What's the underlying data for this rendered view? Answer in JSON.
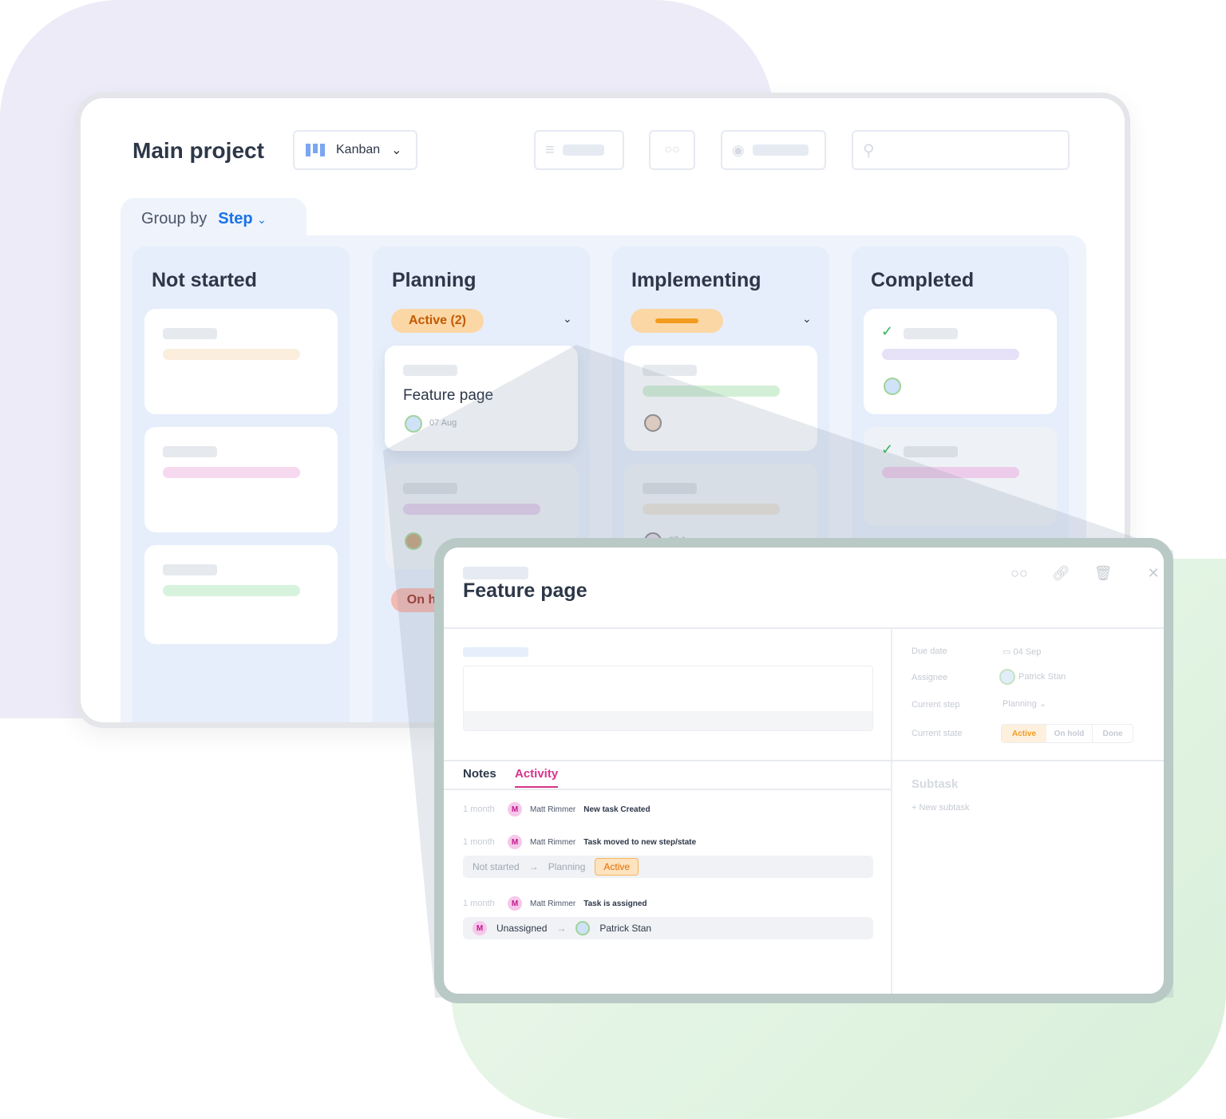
{
  "header": {
    "title": "Main project",
    "view": "Kanban"
  },
  "group_by": {
    "label": "Group by",
    "value": "Step"
  },
  "columns": [
    {
      "title": "Not started"
    },
    {
      "title": "Planning",
      "chip": "Active (2)",
      "chip2": "On hold",
      "card": {
        "title": "Feature page",
        "date": "07 Aug"
      }
    },
    {
      "title": "Implementing",
      "date": "07 Aug"
    },
    {
      "title": "Completed"
    }
  ],
  "detail": {
    "title": "Feature page",
    "fields": {
      "due_label": "Due date",
      "due": "04 Sep",
      "assignee_label": "Assignee",
      "assignee": "Patrick Stan",
      "step_label": "Current step",
      "step": "Planning",
      "state_label": "Current state",
      "states": [
        "Active",
        "On hold",
        "Done"
      ]
    },
    "tabs": [
      "Notes",
      "Activity"
    ],
    "subtask": {
      "title": "Subtask",
      "new": "+ New subtask"
    },
    "activity": [
      {
        "time": "1 month",
        "avatar": "M",
        "user": "Matt Rimmer",
        "text": "New task Created"
      },
      {
        "time": "1 month",
        "avatar": "M",
        "user": "Matt Rimmer",
        "text": "Task moved to new step/state",
        "from": "Not started",
        "to": "Planning",
        "state": "Active"
      },
      {
        "time": "1 month",
        "avatar": "M",
        "user": "Matt Rimmer",
        "text": "Task is assigned",
        "from": "Unassigned",
        "to": "Patrick Stan"
      }
    ]
  },
  "colors": {
    "accent": "#1a73e8",
    "activity_tab": "#d6338c",
    "active": "#f29b1e"
  }
}
